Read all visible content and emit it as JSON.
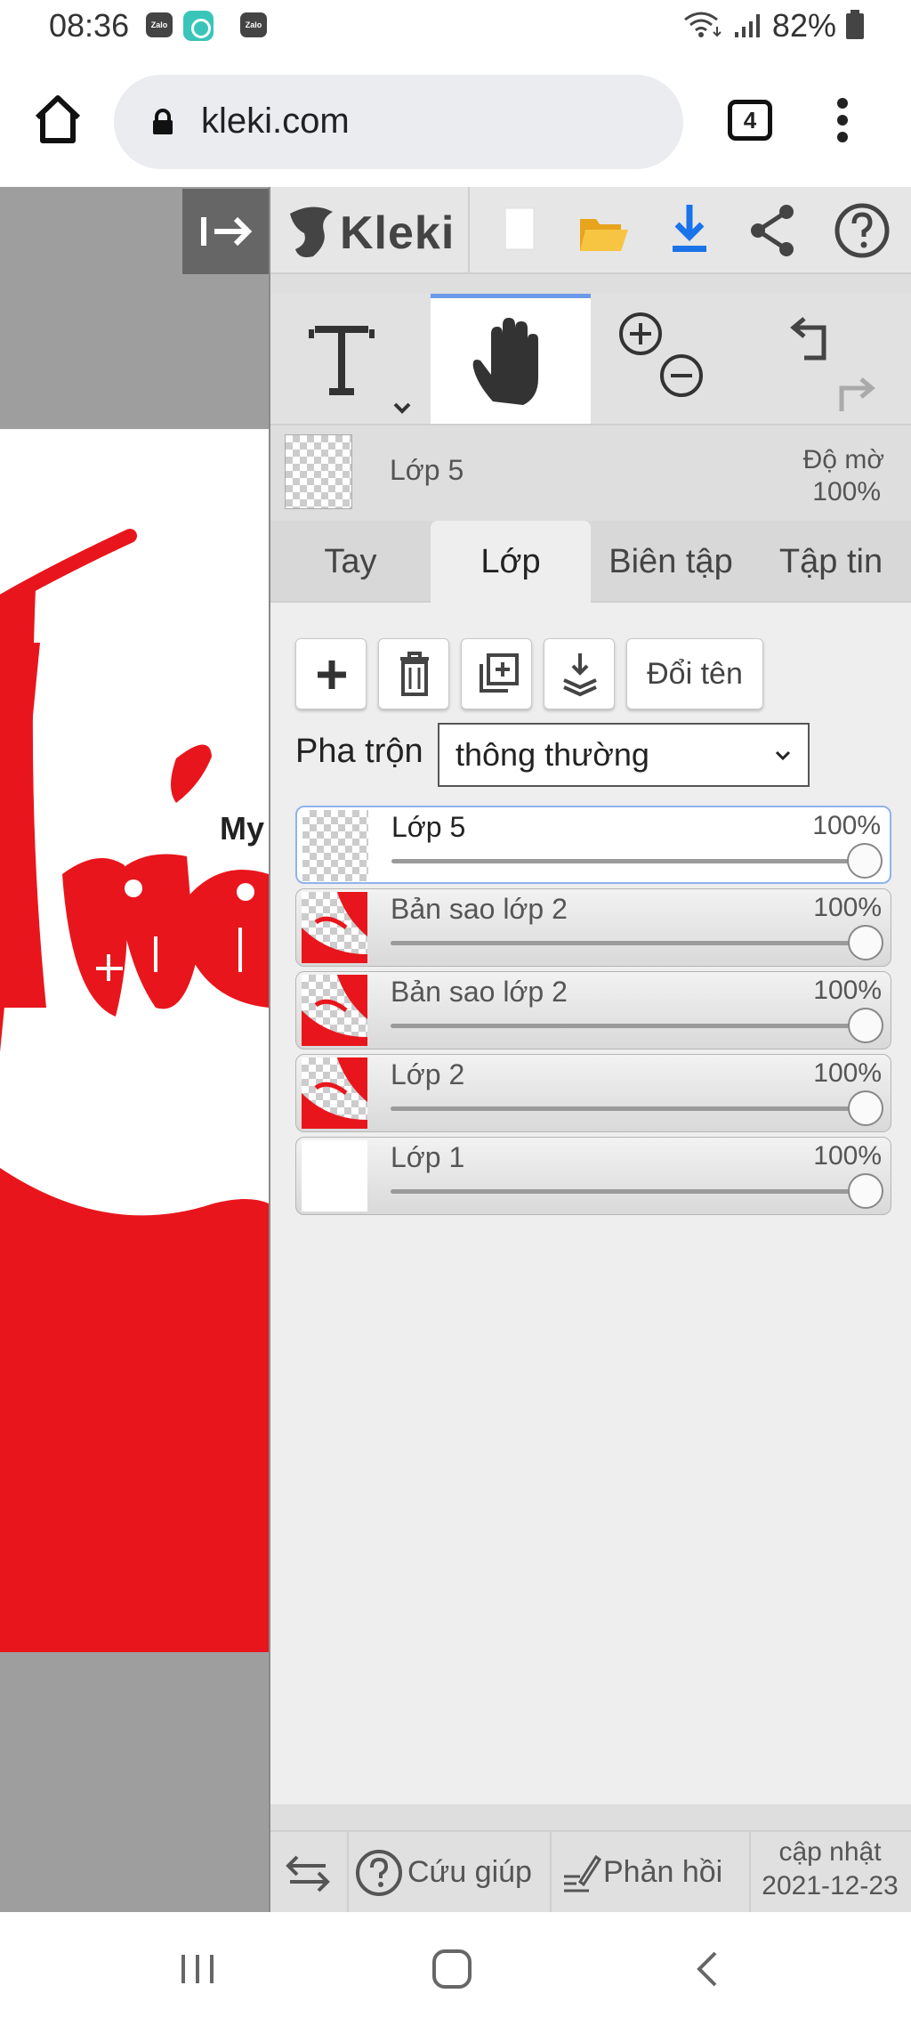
{
  "status_bar": {
    "time": "08:36",
    "notification_icons": [
      "zalo-icon",
      "moji-icon",
      "zalo-icon"
    ],
    "zalo_label": "Zalo",
    "battery": "82%"
  },
  "browser": {
    "url": "kleki.com",
    "tab_count": "4"
  },
  "canvas": {
    "visible_text": "My"
  },
  "toolbar": {
    "app_name": "Kleki",
    "accent_color": "#1a73e8"
  },
  "layer_header": {
    "name": "Lớp 5",
    "opacity_label": "Độ mờ",
    "opacity_value": "100%"
  },
  "tabs": [
    {
      "label": "Tay"
    },
    {
      "label": "Lớp"
    },
    {
      "label": "Biên tập"
    },
    {
      "label": "Tập tin"
    }
  ],
  "layer_panel": {
    "rename_label": "Đổi tên",
    "blend_label": "Pha trộn",
    "blend_value": "thông thường",
    "layers": [
      {
        "name": "Lớp 5",
        "opacity": "100%",
        "selected": true
      },
      {
        "name": "Bản sao lớp 2",
        "opacity": "100%"
      },
      {
        "name": "Bản sao lớp 2",
        "opacity": "100%"
      },
      {
        "name": "Lớp 2",
        "opacity": "100%"
      },
      {
        "name": "Lớp 1",
        "opacity": "100%"
      }
    ]
  },
  "bottom_bar": {
    "help_label": "Cứu giúp",
    "feedback_label": "Phản hồi",
    "update_title": "cập nhật",
    "update_date": "2021-12-23"
  }
}
